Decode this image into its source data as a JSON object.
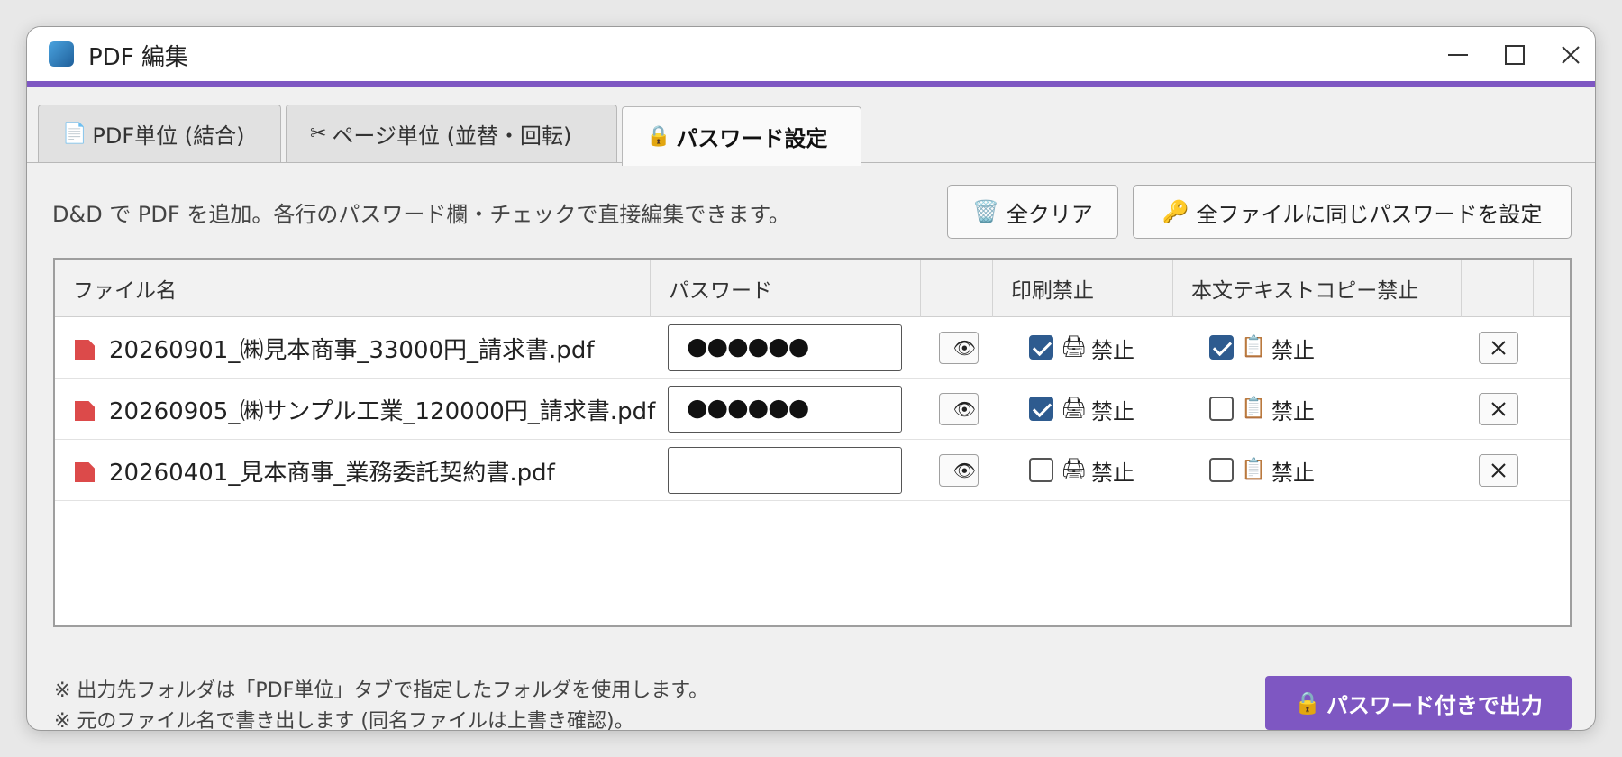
{
  "window": {
    "title": "PDF 編集",
    "accent_color": "#7e57c2"
  },
  "tabs": [
    {
      "label": "PDF単位 (結合)",
      "icon": "📄",
      "icon_name": "document-icon",
      "active": false
    },
    {
      "label": "ページ単位 (並替・回転)",
      "icon": "✂",
      "icon_name": "scissors-icon",
      "active": false
    },
    {
      "label": "パスワード設定",
      "icon": "🔒",
      "icon_name": "lock-icon",
      "active": true
    }
  ],
  "instructions": "D&D で PDF を追加。各行のパスワード欄・チェックで直接編集できます。",
  "toolbar": {
    "clear_all": {
      "label": "全クリア",
      "icon": "🗑️",
      "icon_name": "trash-icon"
    },
    "set_all_password": {
      "label": "全ファイルに同じパスワードを設定",
      "icon": "🔑",
      "icon_name": "key-icon"
    }
  },
  "table": {
    "columns": [
      "ファイル名",
      "パスワード",
      "",
      "印刷禁止",
      "本文テキストコピー禁止",
      ""
    ],
    "rows": [
      {
        "filename": "20260901_㈱見本商事_33000円_請求書.pdf",
        "password_mask": "●●●●●●",
        "print_forbidden": true,
        "print_label": "禁止",
        "copy_forbidden": true,
        "copy_label": "禁止"
      },
      {
        "filename": "20260905_㈱サンプル工業_120000円_請求書.pdf",
        "password_mask": "●●●●●●",
        "print_forbidden": true,
        "print_label": "禁止",
        "copy_forbidden": false,
        "copy_label": "禁止"
      },
      {
        "filename": "20260401_見本商事_業務委託契約書.pdf",
        "password_mask": "",
        "print_forbidden": false,
        "print_label": "禁止",
        "copy_forbidden": false,
        "copy_label": "禁止"
      }
    ],
    "icons": {
      "eye": "👁",
      "print": "🖨",
      "copy": "📋"
    }
  },
  "footer": {
    "note_1": "※ 出力先フォルダは「PDF単位」タブで指定したフォルダを使用します。",
    "note_2": "※ 元のファイル名で書き出します (同名ファイルは上書き確認)。",
    "export_button": {
      "label": "パスワード付きで出力",
      "icon": "🔒",
      "icon_name": "lock-icon"
    }
  }
}
